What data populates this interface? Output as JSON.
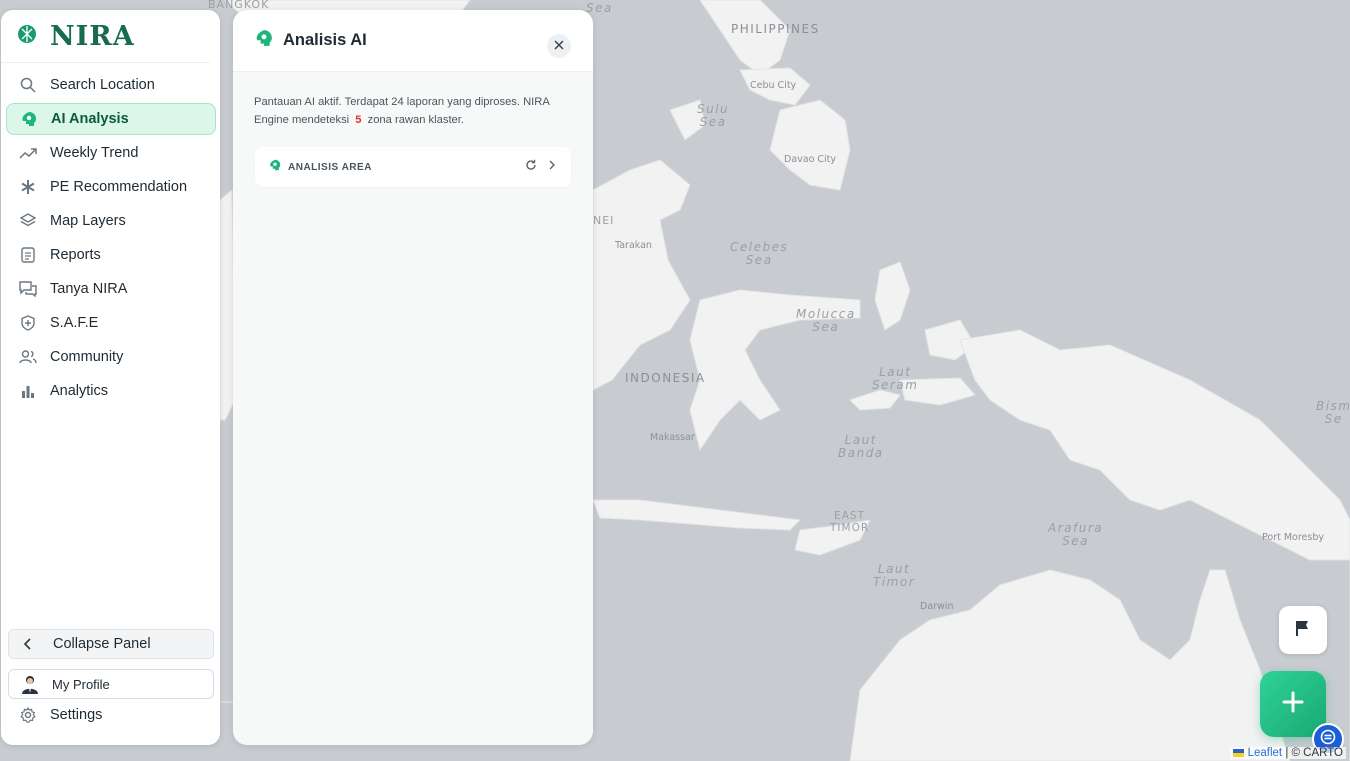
{
  "app": {
    "brand": "NIRA"
  },
  "sidebar": {
    "items": [
      {
        "label": "Search Location",
        "icon": "search-icon"
      },
      {
        "label": "AI Analysis",
        "icon": "ai-brain-icon",
        "active": true
      },
      {
        "label": "Weekly Trend",
        "icon": "trending-up-icon"
      },
      {
        "label": "PE Recommendation",
        "icon": "asterisk-icon"
      },
      {
        "label": "Map Layers",
        "icon": "layers-icon"
      },
      {
        "label": "Reports",
        "icon": "document-icon"
      },
      {
        "label": "Tanya NIRA",
        "icon": "chat-icon"
      },
      {
        "label": "S.A.F.E",
        "icon": "shield-icon"
      },
      {
        "label": "Community",
        "icon": "users-icon"
      },
      {
        "label": "Analytics",
        "icon": "bar-chart-icon"
      }
    ],
    "collapse_label": "Collapse Panel",
    "profile_label": "My Profile",
    "settings_label": "Settings"
  },
  "panel": {
    "title": "Analisis AI",
    "summary_before": "Pantauan AI aktif. Terdapat 24 laporan yang diproses. NIRA Engine mendeteksi",
    "zone_count": "5",
    "summary_after": "zona rawan klaster.",
    "area_label": "ANALISIS AREA"
  },
  "map": {
    "labels": {
      "bangkok": "BANGKOK",
      "sea_top": "Sea",
      "philippines": "PHILIPPINES",
      "cebu": "Cebu City",
      "sulu": "Sulu\nSea",
      "davao": "Davao City",
      "nei": "NEI",
      "tarakan": "Tarakan",
      "celebes": "Celebes\nSea",
      "molucca": "Molucca\nSea",
      "laut_seram": "Laut\nSeram",
      "indonesia": "INDONESIA",
      "makassar": "Makassar",
      "laut_banda": "Laut\nBanda",
      "east_timor": "EAST\nTIMOR",
      "arafura": "Arafura\nSea",
      "port_moresby": "Port Moresby",
      "laut_timor": "Laut\nTimor",
      "darwin": "Darwin",
      "bism": "Bism\nSe"
    },
    "colors": {
      "water": "#c8ccd0",
      "land": "#f2f2f2"
    }
  },
  "attribution": {
    "leaflet": "Leaflet",
    "carto": "| © CARTO"
  },
  "colors": {
    "accent": "#1fb57f",
    "active_bg": "#dcf6ea",
    "highlight": "#e03131"
  }
}
